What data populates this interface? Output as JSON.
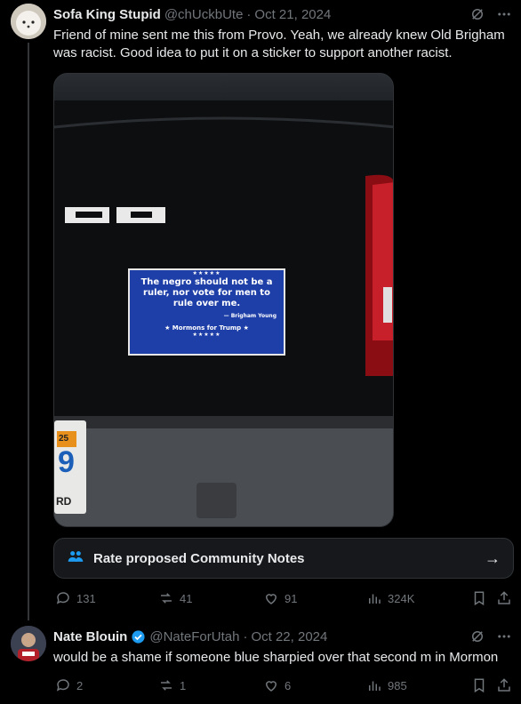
{
  "tweet1": {
    "name": "Sofa King Stupid",
    "handle": "@chUckbUte",
    "dot": "·",
    "date": "Oct 21, 2024",
    "text": "Friend of mine sent me this from Provo. Yeah, we already knew Old Brigham was racist. Good idea to put it on a sticker to support another racist.",
    "image": {
      "sticker_stars": "★★★★★",
      "sticker_quote": "The negro should not be a ruler, nor vote for men to rule over me.",
      "sticker_attribution": "— Brigham Young",
      "sticker_slogan": "★ Mormons for Trump ★",
      "badge_text": "25",
      "plate_number": "9",
      "plate_text": "RD"
    },
    "community_notes_label": "Rate proposed Community Notes",
    "stats": {
      "replies": "131",
      "reposts": "41",
      "likes": "91",
      "views": "324K"
    }
  },
  "tweet2": {
    "name": "Nate Blouin",
    "handle": "@NateForUtah",
    "dot": "·",
    "date": "Oct 22, 2024",
    "text": "would be a shame if someone blue sharpied over that second m in Mormon",
    "stats": {
      "replies": "2",
      "reposts": "1",
      "likes": "6",
      "views": "985"
    }
  },
  "colors": {
    "background": "#000000",
    "text": "#e7e9ea",
    "muted": "#71767b",
    "verified": "#1d9bf0",
    "sticker_blue": "#1f3fa8"
  }
}
